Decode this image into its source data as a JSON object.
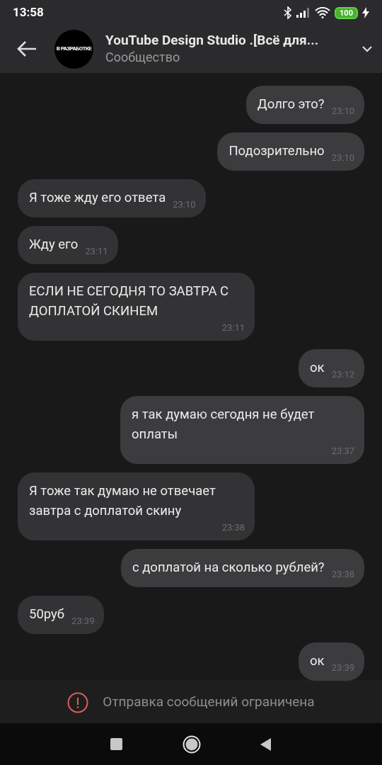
{
  "status_bar": {
    "time": "13:58",
    "battery": "100"
  },
  "header": {
    "avatar_label": "В РАЗРАБОТКЕ",
    "title": "YouTube Design Studio .[Всё для...",
    "subtitle": "Сообщество"
  },
  "messages": [
    {
      "text": "Долго это?",
      "time": "23:10",
      "outgoing": true
    },
    {
      "text": "Подозрительно",
      "time": "23:10",
      "outgoing": true
    },
    {
      "text": "Я тоже жду его ответа",
      "time": "23:10",
      "outgoing": false
    },
    {
      "text": "Жду его",
      "time": "23:11",
      "outgoing": false
    },
    {
      "text": "ЕСЛИ НЕ СЕГОДНЯ ТО ЗАВТРА С ДОПЛАТОЙ СКИНЕМ",
      "time": "23:11",
      "outgoing": false
    },
    {
      "text": "ок",
      "time": "23:12",
      "outgoing": true
    },
    {
      "text": "я так думаю сегодня не будет оплаты",
      "time": "23:37",
      "outgoing": true
    },
    {
      "text": "Я тоже так думаю не отвечает завтра с доплатой скину",
      "time": "23:38",
      "outgoing": false
    },
    {
      "text": "с доплатой на сколько рублей?",
      "time": "23:38",
      "outgoing": true
    },
    {
      "text": "50руб",
      "time": "23:39",
      "outgoing": false
    },
    {
      "text": "ок",
      "time": "23:39",
      "outgoing": true
    }
  ],
  "notice": "Отправка сообщений ограничена"
}
